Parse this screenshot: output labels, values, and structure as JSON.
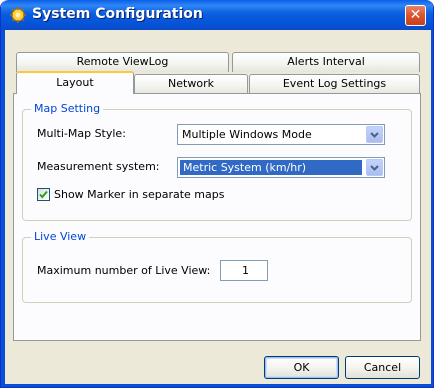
{
  "window": {
    "title": "System Configuration",
    "close_label": "✕"
  },
  "tabs": {
    "row_back": [
      {
        "label": "Remote ViewLog"
      },
      {
        "label": "Alerts Interval"
      }
    ],
    "row_front": [
      {
        "label": "Layout",
        "active": true
      },
      {
        "label": "Network"
      },
      {
        "label": "Event Log Settings"
      }
    ]
  },
  "map_setting": {
    "title": "Map Setting",
    "multi_map_label": "Multi-Map Style:",
    "multi_map_value": "Multiple Windows Mode",
    "measurement_label": "Measurement system:",
    "measurement_value": "Metric System (km/hr)",
    "show_marker_label": "Show Marker in separate maps",
    "show_marker_checked": true
  },
  "live_view": {
    "title": "Live View",
    "max_label": "Maximum number of Live View:",
    "max_value": "1"
  },
  "buttons": {
    "ok": "OK",
    "cancel": "Cancel"
  },
  "colors": {
    "titlebar": "#0a5ee8",
    "group_title": "#0046d5",
    "selection": "#316ac5",
    "close": "#d9542c"
  }
}
